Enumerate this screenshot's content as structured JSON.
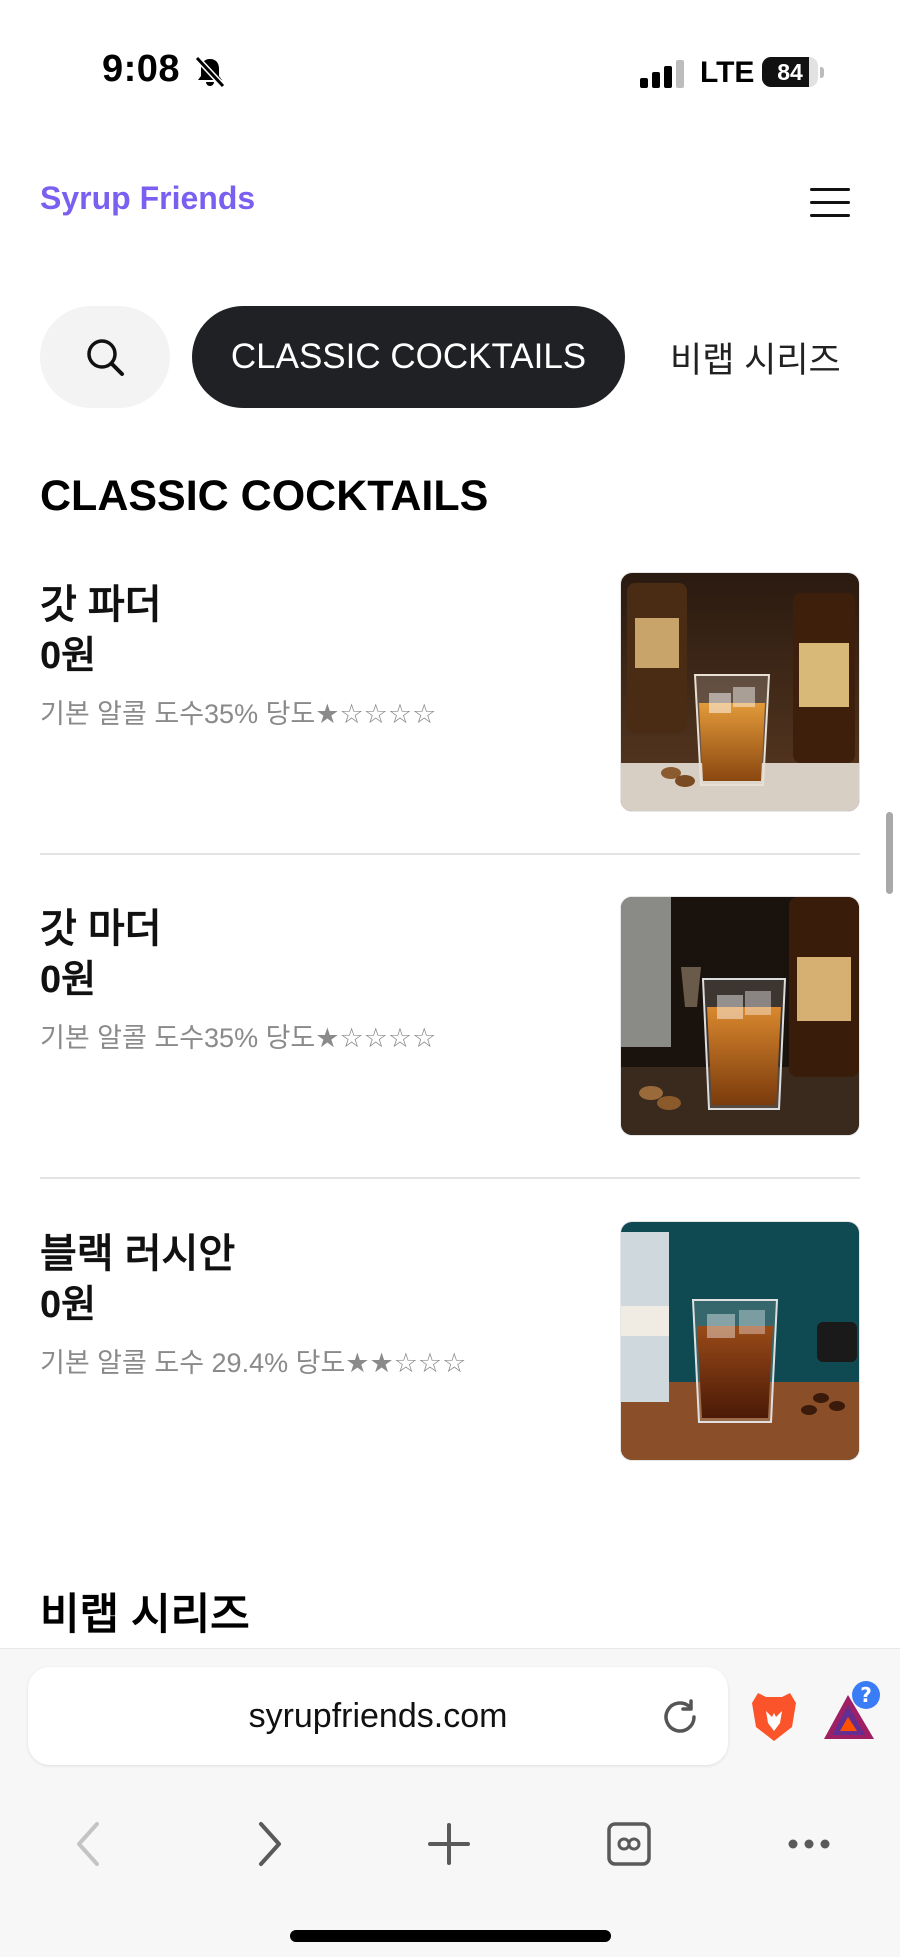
{
  "status_bar": {
    "time": "9:08",
    "network": "LTE",
    "battery": "84",
    "battery_level": 0.84,
    "icons": [
      "bell-slash-icon",
      "signal-icon"
    ]
  },
  "header": {
    "logo": "Syrup Friends",
    "logo_color": "#7b5ff0",
    "menu_icon": "hamburger-menu-icon"
  },
  "category_tabs": {
    "search_icon": "search-icon",
    "active": "CLASSIC COCKTAILS",
    "next": "비랩 시리즈"
  },
  "sections": [
    {
      "title": "CLASSIC COCKTAILS",
      "items": [
        {
          "name": "갓 파더",
          "price": "0원",
          "spec": "기본 알콜 도수35%  당도★☆☆☆☆"
        },
        {
          "name": "갓 마더",
          "price": "0원",
          "spec": "기본 알콜 도수35%  당도★☆☆☆☆"
        },
        {
          "name": "블랙 러시안",
          "price": "0원",
          "spec": "기본 알콜 도수 29.4%  당도★★☆☆☆"
        }
      ]
    },
    {
      "title": "비랩 시리즈",
      "items": []
    }
  ],
  "browser": {
    "url": "syrupfriends.com",
    "icons": [
      "reload-icon",
      "brave-lion-icon",
      "bat-rewards-icon",
      "back-icon",
      "forward-icon",
      "new-tab-icon",
      "tabs-icon",
      "more-icon"
    ],
    "bat_badge": "?"
  },
  "colors": {
    "accent": "#7b5ff0",
    "active_tab": "#202124",
    "brave": "#fb542b"
  }
}
